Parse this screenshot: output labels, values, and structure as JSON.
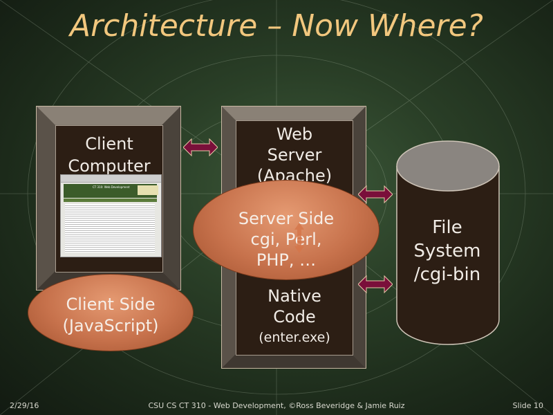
{
  "title": "Architecture – Now Where?",
  "client": {
    "line1": "Client",
    "line2": "Computer"
  },
  "server": {
    "line1": "Web",
    "line2": "Server",
    "line3": "(Apache)"
  },
  "native": {
    "line1": "Native",
    "line2": "Code",
    "line3": "(enter.exe)"
  },
  "server_side": {
    "line1": "Server Side",
    "line2": "cgi, Perl,",
    "line3": "PHP, …"
  },
  "client_side": {
    "line1": "Client Side",
    "line2": "(JavaScript)"
  },
  "filesystem": {
    "line1": "File",
    "line2": "System",
    "line3": "/cgi-bin"
  },
  "screenshot": {
    "header": "CT 310: Web Development"
  },
  "footer": {
    "date": "2/29/16",
    "center": "CSU CS CT 310 - Web Development, ©Ross Beveridge & Jamie Ruiz",
    "slide": "Slide 10"
  },
  "colors": {
    "title": "#f2c77e",
    "arrow": "#7a0f3a",
    "oval": "#c7724c",
    "box": "#2c1e14"
  }
}
